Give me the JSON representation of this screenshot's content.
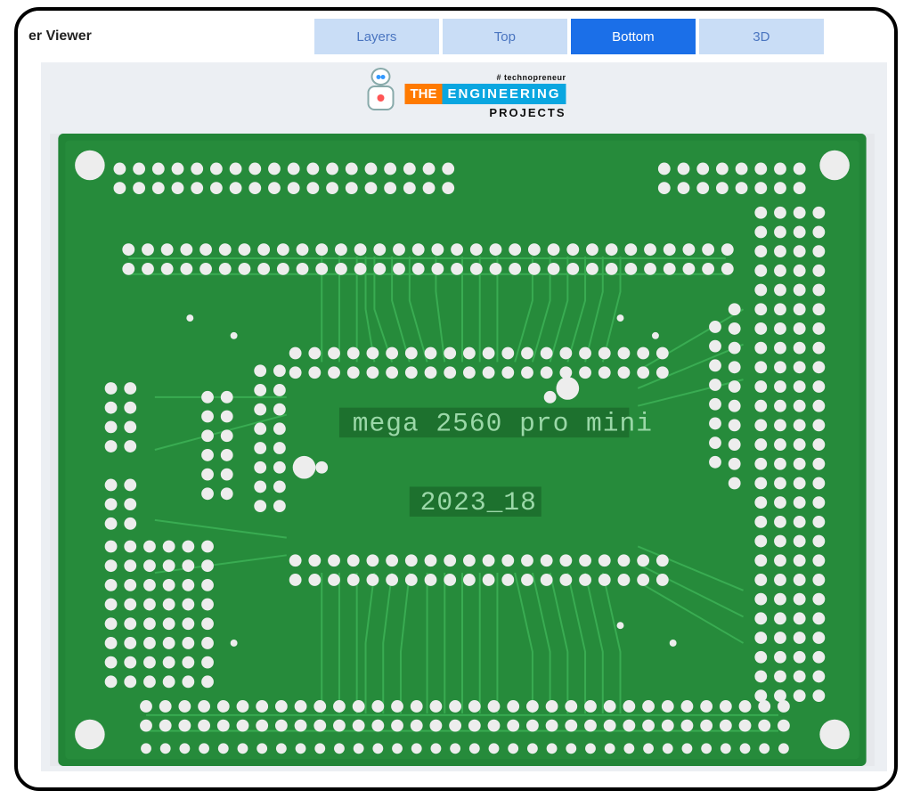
{
  "header": {
    "title_fragment": "er Viewer"
  },
  "tabs": [
    {
      "label": "Layers",
      "active": false
    },
    {
      "label": "Top",
      "active": false
    },
    {
      "label": "Bottom",
      "active": true
    },
    {
      "label": "3D",
      "active": false
    }
  ],
  "logo": {
    "tagline": "# technopreneur",
    "word_the": "THE",
    "word_eng": "ENGINEERING",
    "word_proj": "PROJECTS"
  },
  "pcb": {
    "silk_line1": "mega 2560 pro mini",
    "silk_line2": "2023_18",
    "board_color": "#248a3a",
    "board_dark": "#1f7a33",
    "pad_color": "#ededed",
    "trace_color": "#34a24c"
  }
}
